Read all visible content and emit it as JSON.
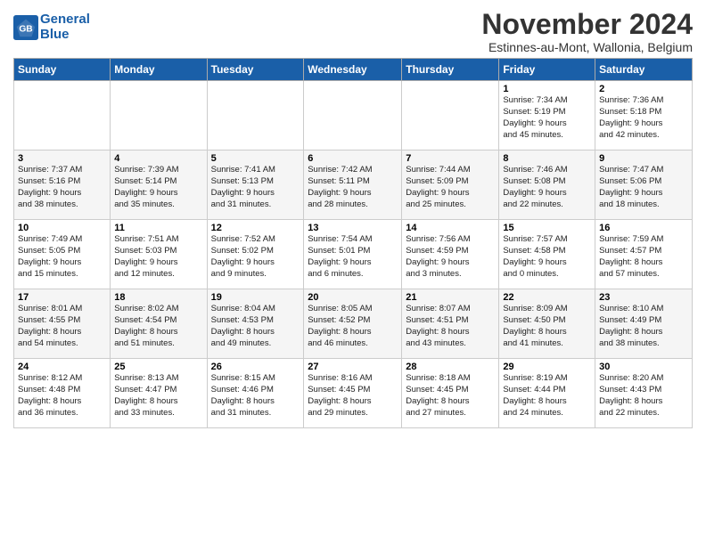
{
  "logo": {
    "line1": "General",
    "line2": "Blue"
  },
  "title": "November 2024",
  "location": "Estinnes-au-Mont, Wallonia, Belgium",
  "weekdays": [
    "Sunday",
    "Monday",
    "Tuesday",
    "Wednesday",
    "Thursday",
    "Friday",
    "Saturday"
  ],
  "weeks": [
    [
      {
        "day": "",
        "info": ""
      },
      {
        "day": "",
        "info": ""
      },
      {
        "day": "",
        "info": ""
      },
      {
        "day": "",
        "info": ""
      },
      {
        "day": "",
        "info": ""
      },
      {
        "day": "1",
        "info": "Sunrise: 7:34 AM\nSunset: 5:19 PM\nDaylight: 9 hours\nand 45 minutes."
      },
      {
        "day": "2",
        "info": "Sunrise: 7:36 AM\nSunset: 5:18 PM\nDaylight: 9 hours\nand 42 minutes."
      }
    ],
    [
      {
        "day": "3",
        "info": "Sunrise: 7:37 AM\nSunset: 5:16 PM\nDaylight: 9 hours\nand 38 minutes."
      },
      {
        "day": "4",
        "info": "Sunrise: 7:39 AM\nSunset: 5:14 PM\nDaylight: 9 hours\nand 35 minutes."
      },
      {
        "day": "5",
        "info": "Sunrise: 7:41 AM\nSunset: 5:13 PM\nDaylight: 9 hours\nand 31 minutes."
      },
      {
        "day": "6",
        "info": "Sunrise: 7:42 AM\nSunset: 5:11 PM\nDaylight: 9 hours\nand 28 minutes."
      },
      {
        "day": "7",
        "info": "Sunrise: 7:44 AM\nSunset: 5:09 PM\nDaylight: 9 hours\nand 25 minutes."
      },
      {
        "day": "8",
        "info": "Sunrise: 7:46 AM\nSunset: 5:08 PM\nDaylight: 9 hours\nand 22 minutes."
      },
      {
        "day": "9",
        "info": "Sunrise: 7:47 AM\nSunset: 5:06 PM\nDaylight: 9 hours\nand 18 minutes."
      }
    ],
    [
      {
        "day": "10",
        "info": "Sunrise: 7:49 AM\nSunset: 5:05 PM\nDaylight: 9 hours\nand 15 minutes."
      },
      {
        "day": "11",
        "info": "Sunrise: 7:51 AM\nSunset: 5:03 PM\nDaylight: 9 hours\nand 12 minutes."
      },
      {
        "day": "12",
        "info": "Sunrise: 7:52 AM\nSunset: 5:02 PM\nDaylight: 9 hours\nand 9 minutes."
      },
      {
        "day": "13",
        "info": "Sunrise: 7:54 AM\nSunset: 5:01 PM\nDaylight: 9 hours\nand 6 minutes."
      },
      {
        "day": "14",
        "info": "Sunrise: 7:56 AM\nSunset: 4:59 PM\nDaylight: 9 hours\nand 3 minutes."
      },
      {
        "day": "15",
        "info": "Sunrise: 7:57 AM\nSunset: 4:58 PM\nDaylight: 9 hours\nand 0 minutes."
      },
      {
        "day": "16",
        "info": "Sunrise: 7:59 AM\nSunset: 4:57 PM\nDaylight: 8 hours\nand 57 minutes."
      }
    ],
    [
      {
        "day": "17",
        "info": "Sunrise: 8:01 AM\nSunset: 4:55 PM\nDaylight: 8 hours\nand 54 minutes."
      },
      {
        "day": "18",
        "info": "Sunrise: 8:02 AM\nSunset: 4:54 PM\nDaylight: 8 hours\nand 51 minutes."
      },
      {
        "day": "19",
        "info": "Sunrise: 8:04 AM\nSunset: 4:53 PM\nDaylight: 8 hours\nand 49 minutes."
      },
      {
        "day": "20",
        "info": "Sunrise: 8:05 AM\nSunset: 4:52 PM\nDaylight: 8 hours\nand 46 minutes."
      },
      {
        "day": "21",
        "info": "Sunrise: 8:07 AM\nSunset: 4:51 PM\nDaylight: 8 hours\nand 43 minutes."
      },
      {
        "day": "22",
        "info": "Sunrise: 8:09 AM\nSunset: 4:50 PM\nDaylight: 8 hours\nand 41 minutes."
      },
      {
        "day": "23",
        "info": "Sunrise: 8:10 AM\nSunset: 4:49 PM\nDaylight: 8 hours\nand 38 minutes."
      }
    ],
    [
      {
        "day": "24",
        "info": "Sunrise: 8:12 AM\nSunset: 4:48 PM\nDaylight: 8 hours\nand 36 minutes."
      },
      {
        "day": "25",
        "info": "Sunrise: 8:13 AM\nSunset: 4:47 PM\nDaylight: 8 hours\nand 33 minutes."
      },
      {
        "day": "26",
        "info": "Sunrise: 8:15 AM\nSunset: 4:46 PM\nDaylight: 8 hours\nand 31 minutes."
      },
      {
        "day": "27",
        "info": "Sunrise: 8:16 AM\nSunset: 4:45 PM\nDaylight: 8 hours\nand 29 minutes."
      },
      {
        "day": "28",
        "info": "Sunrise: 8:18 AM\nSunset: 4:45 PM\nDaylight: 8 hours\nand 27 minutes."
      },
      {
        "day": "29",
        "info": "Sunrise: 8:19 AM\nSunset: 4:44 PM\nDaylight: 8 hours\nand 24 minutes."
      },
      {
        "day": "30",
        "info": "Sunrise: 8:20 AM\nSunset: 4:43 PM\nDaylight: 8 hours\nand 22 minutes."
      }
    ]
  ]
}
